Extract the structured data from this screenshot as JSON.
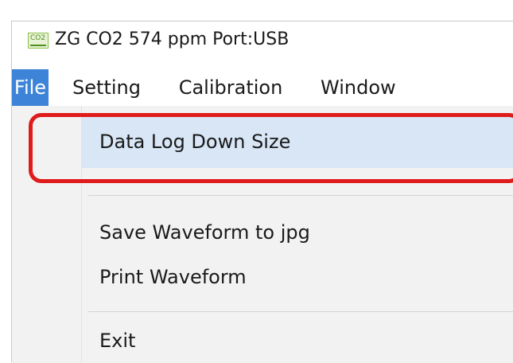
{
  "window": {
    "title": "ZG CO2 574 ppm  Port:USB",
    "icon": "co2-app-icon",
    "icon_text": "CO2"
  },
  "menubar": {
    "items": [
      {
        "label": "File",
        "active": true
      },
      {
        "label": "Setting",
        "active": false
      },
      {
        "label": "Calibration",
        "active": false
      },
      {
        "label": "Window",
        "active": false
      }
    ]
  },
  "file_menu": {
    "items": [
      {
        "label": "Data Log Down Size",
        "highlighted": true
      },
      {
        "label": "Save Waveform to jpg"
      },
      {
        "label": "Print Waveform"
      },
      {
        "label": "Exit"
      }
    ]
  },
  "colors": {
    "active_menu": "#3d84d8",
    "hover_item": "#d8e6f6",
    "annotation": "#e01b1b"
  }
}
